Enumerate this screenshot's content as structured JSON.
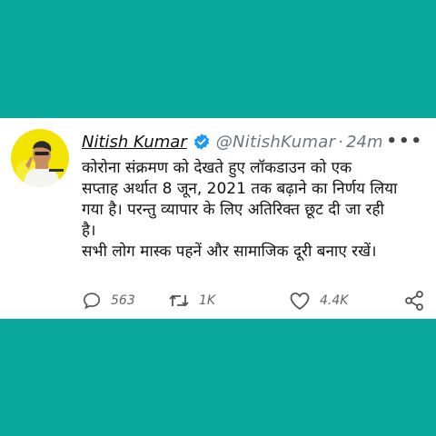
{
  "tweet": {
    "display_name": "Nitish Kumar",
    "handle": "@NitishKumar",
    "separator": "·",
    "time": "24m",
    "text_lines": [
      "कोरोना संक्रमण को देखते हुए लॉकडाउन को एक",
      "सप्ताह अर्थात 8 जून, 2021 तक बढ़ाने का निर्णय लिया",
      "गया है। परन्तु व्यापार के लिए अतिरिक्त छूट दी जा रही",
      "है।",
      "सभी लोग मास्क पहनें और सामाजिक दूरी बनाए रखें।"
    ],
    "replies": "563",
    "retweets": "1K",
    "likes": "4.4K",
    "more_glyph": "•••"
  },
  "colors": {
    "background": "#0aa89d",
    "card": "#ffffff",
    "verified": "#1d9bf0",
    "muted": "#6b7680"
  },
  "icons": [
    "verified-badge-icon",
    "more-options-icon",
    "reply-icon",
    "retweet-icon",
    "like-icon",
    "share-icon"
  ]
}
